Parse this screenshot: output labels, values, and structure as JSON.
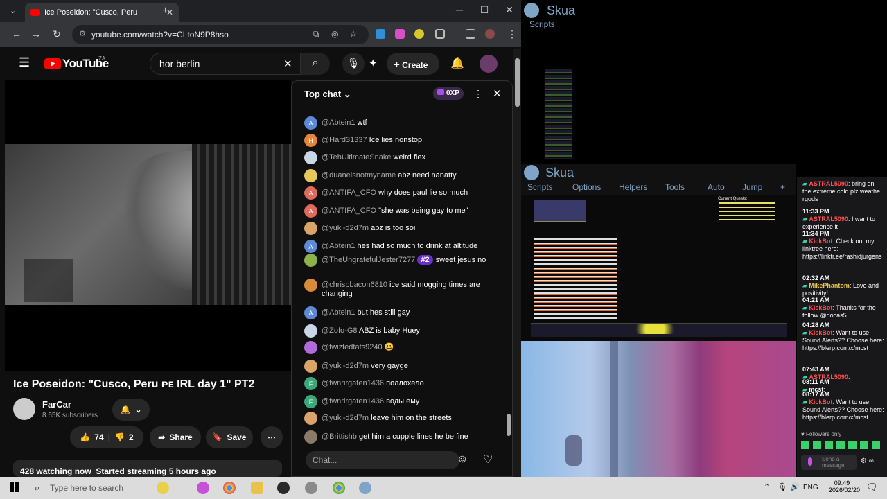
{
  "browser": {
    "tab_title": "Ice Poseidon: \"Cusco, Peru",
    "url": "youtube.com/watch?v=CLtoN9P8hso"
  },
  "youtube": {
    "logo": "YouTube",
    "region": "ZA",
    "search_value": "hor berlin",
    "create_label": "Create",
    "video_title": "Ice Poseidon: \"Cusco, Peru ᴘᴇ IRL day 1\" PT2",
    "channel": "FarCar",
    "subscribers": "8.65K subscribers",
    "likes": "74",
    "dislikes": "2",
    "share_label": "Share",
    "save_label": "Save",
    "watching": "428 watching now",
    "started": "Started streaming 5 hours ago"
  },
  "chat": {
    "header": "Top chat",
    "xp": "0XP",
    "input_placeholder": "Chat...",
    "messages": [
      {
        "author": "@Abtein1",
        "text": "wtf",
        "av": "A",
        "color": "#5c8ad6"
      },
      {
        "author": "@Hard31337",
        "text": "Ice lies nonstop",
        "av": "H",
        "color": "#e8833a"
      },
      {
        "author": "@TehUltimateSnake",
        "text": "weird flex",
        "av": "",
        "color": "#c9d6e8"
      },
      {
        "author": "@duaneisnotmyname",
        "text": "abz need nanatty",
        "av": "",
        "color": "#e6c75a"
      },
      {
        "author": "@ANTIFA_CFO",
        "text": "why does paul lie so much",
        "av": "A",
        "color": "#e06a5c"
      },
      {
        "author": "@ANTIFA_CFO",
        "text": "\"she was being gay to me\"",
        "av": "A",
        "color": "#e06a5c"
      },
      {
        "author": "@yuki-d2d7m",
        "text": "abz is too soi",
        "av": "",
        "color": "#d9a36a"
      },
      {
        "author": "@Abtein1",
        "text": "hes had so much to drink at altitude",
        "av": "A",
        "color": "#5c8ad6"
      },
      {
        "author": "@TheUngratefulJester7277",
        "text": "sweet jesus no",
        "av": "",
        "color": "#8bb34a",
        "badge": "#2"
      },
      {
        "author": "@chrispbacon6810",
        "text": "ice said mogging times are changing",
        "av": "",
        "color": "#d98a3a"
      },
      {
        "author": "@Abtein1",
        "text": "but hes still gay",
        "av": "A",
        "color": "#5c8ad6"
      },
      {
        "author": "@Zofo-G8",
        "text": "ABZ is baby Huey",
        "av": "",
        "color": "#c9d6e8"
      },
      {
        "author": "@twiztedtats9240",
        "text": "😀",
        "av": "",
        "color": "#b06ad9"
      },
      {
        "author": "@yuki-d2d7m",
        "text": "very gayge",
        "av": "",
        "color": "#d9a36a"
      },
      {
        "author": "@fwnrirgaten1436",
        "text": "поллохело",
        "av": "F",
        "color": "#3aa87a"
      },
      {
        "author": "@fwnrirgaten1436",
        "text": "воды ему",
        "av": "F",
        "color": "#3aa87a"
      },
      {
        "author": "@yuki-d2d7m",
        "text": "leave him on the streets",
        "av": "",
        "color": "#d9a36a"
      },
      {
        "author": "@Brittishb",
        "text": "get him a cupple lines he be fine",
        "av": "",
        "color": "#8a7a6a"
      }
    ]
  },
  "skua": {
    "title": "Skua",
    "menu": [
      "Scripts",
      "Options",
      "Helpers",
      "Tools",
      "Auto",
      "Jump",
      "+"
    ],
    "scripts_label": "Scripts",
    "quest_title": "Current Quests:"
  },
  "twitch": {
    "messages": [
      {
        "time": "",
        "user": "ASTRAL5090",
        "text": ": bring on the extreme cold plz weathe rgods",
        "color": "#ff4f4f"
      },
      {
        "time": "11:33 PM",
        "user": "ASTRAL5090",
        "text": ": I want to experience it",
        "color": "#ff4f4f"
      },
      {
        "time": "11:34 PM",
        "user": "KickBot",
        "text": ": Check out my linktree here: https://linktr.ee/rashidjurgens",
        "color": "#ff4f4f"
      },
      {
        "time": "02:32 AM",
        "user": "MikePhantom",
        "text": ": Love and positivity!",
        "color": "#e8c24a"
      },
      {
        "time": "04:21 AM",
        "user": "KickBot",
        "text": ": Thanks for the follow @docas5",
        "color": "#ff4f4f"
      },
      {
        "time": "04:28 AM",
        "user": "KickBot",
        "text": ": Want to use Sound Alerts?? Choose here: https://blerp.com/x/mcst",
        "color": "#ff4f4f"
      },
      {
        "time": "07:43 AM",
        "user": "ASTRAL5090",
        "text": ":",
        "color": "#ff4f4f"
      },
      {
        "time": "08:11 AM",
        "user": "mcst",
        "text": ":",
        "color": "#fff"
      },
      {
        "time": "08:17 AM",
        "user": "KickBot",
        "text": ": Want to use Sound Alerts?? Choose here: https://blerp.com/x/mcst",
        "color": "#ff4f4f"
      }
    ],
    "followers_only": "Followers only",
    "send_placeholder": "Send a message"
  },
  "taskbar": {
    "search_placeholder": "Type here to search",
    "lang": "ENG",
    "time": "09:49",
    "date": "2026/02/20"
  }
}
